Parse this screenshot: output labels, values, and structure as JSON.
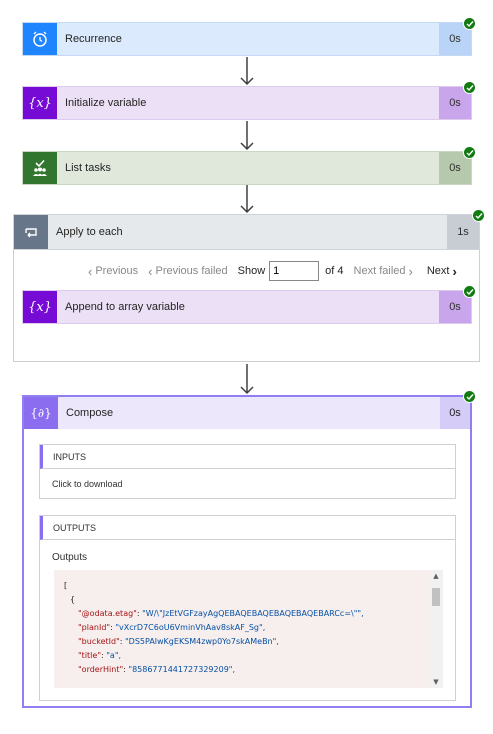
{
  "steps": {
    "recurrence": {
      "label": "Recurrence",
      "duration": "0s",
      "icon": "alarm-clock-icon",
      "color": "#1f85ff"
    },
    "initialize_variable": {
      "label": "Initialize variable",
      "duration": "0s",
      "icon": "variable-icon",
      "color": "#770bd6"
    },
    "list_tasks": {
      "label": "List tasks",
      "duration": "0s",
      "icon": "planner-icon",
      "color": "#31752f"
    },
    "apply_to_each": {
      "label": "Apply to each",
      "duration": "1s",
      "icon": "loop-icon",
      "color": "#68768a"
    },
    "append_to_array": {
      "label": "Append to array variable",
      "duration": "0s",
      "icon": "variable-icon",
      "color": "#770bd6"
    },
    "compose": {
      "label": "Compose",
      "duration": "0s",
      "icon": "compose-icon",
      "color": "#8b6ef0"
    }
  },
  "pager": {
    "previous": "Previous",
    "previous_failed": "Previous failed",
    "show": "Show",
    "current_page": "1",
    "of_total": "of 4",
    "next_failed": "Next failed",
    "next": "Next"
  },
  "inputs": {
    "header": "INPUTS",
    "body": "Click to download"
  },
  "outputs": {
    "header": "OUTPUTS",
    "title": "Outputs",
    "code": {
      "open_bracket": "[",
      "open_brace": "{",
      "etag_key": "\"@odata.etag\"",
      "etag_value": "\"W/\\\"JzEtVGFzayAgQEBAQEBAQEBAQEBAQEBARCc=\\\"\",",
      "planid_key": "\"planId\"",
      "planid_value": "\"vXcrD7C6oU6VminVhAav8skAF_Sg\",",
      "bucketid_key": "\"bucketId\"",
      "bucketid_value": "\"DS5PAlwKgEKSM4zwp0Yo7skAMeBn\",",
      "title_key": "\"title\"",
      "title_value": "\"a\",",
      "orderhint_key": "\"orderHint\"",
      "orderhint_value": "\"8586771441727329209\","
    }
  },
  "status": {
    "success_color": "#107c10"
  }
}
